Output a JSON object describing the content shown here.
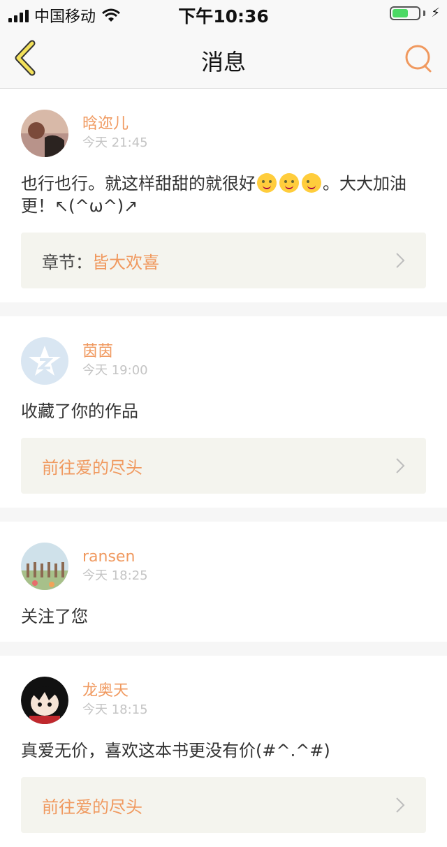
{
  "status_bar": {
    "carrier": "中国移动",
    "time": "下午10:36"
  },
  "nav": {
    "title": "消息",
    "back_icon": "chevron-left-icon",
    "search_icon": "search-icon"
  },
  "colors": {
    "accent": "#f0995f",
    "nav_back": "#f3c64a",
    "background": "#f6f6f6"
  },
  "messages": [
    {
      "username": "晗迩儿",
      "time": "今天 21:45",
      "content_prefix": "也行也行。就这样甜甜的就很好",
      "content_suffix": "。大大加油更！↖(^ω^)↗",
      "link_prefix": "章节：",
      "link_text": "皆大欢喜"
    },
    {
      "username": "茵茵",
      "time": "今天 19:00",
      "content": "收藏了你的作品",
      "link_text": "前往爱的尽头"
    },
    {
      "username": "ransen",
      "time": "今天 18:25",
      "content": "关注了您"
    },
    {
      "username": "龙奥天",
      "time": "今天 18:15",
      "content": "真爱无价，喜欢这本书更没有价(#^.^#)",
      "link_text": "前往爱的尽头"
    }
  ]
}
